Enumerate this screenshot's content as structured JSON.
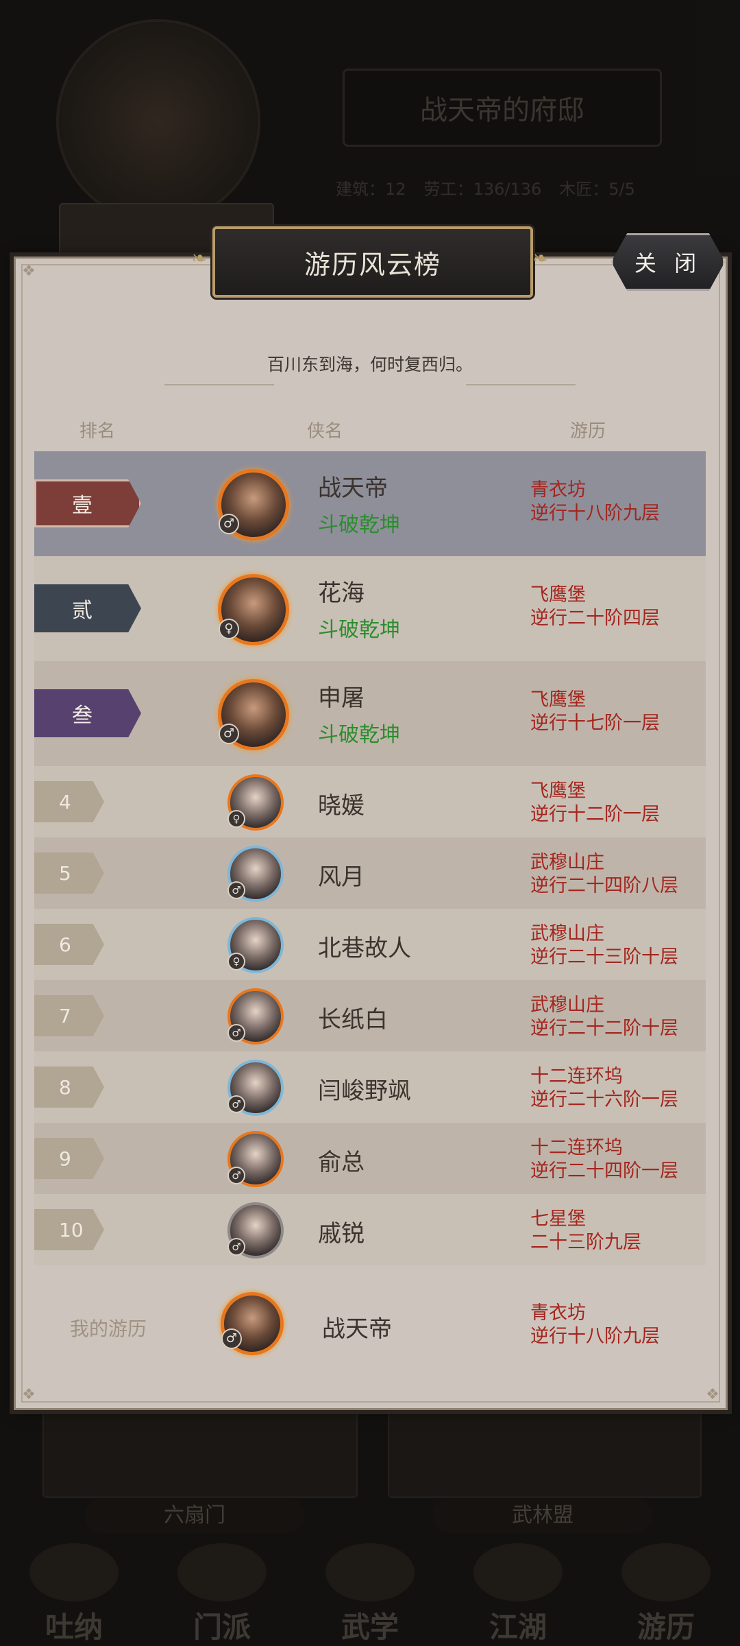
{
  "background": {
    "mansion_title": "战天帝的府邸",
    "stats": [
      "建筑：12",
      "劳工：136/136",
      "木匠：5/5"
    ],
    "cards": [
      "六扇门",
      "武林盟"
    ],
    "nav": [
      "吐纳",
      "门派",
      "武学",
      "江湖",
      "游历"
    ]
  },
  "modal": {
    "title": "游历风云榜",
    "close_label": "关 闭",
    "motto": "百川东到海，何时复西归。",
    "columns": {
      "rank": "排名",
      "name": "侠名",
      "travel": "游历"
    }
  },
  "rankings": [
    {
      "rank": "壹",
      "name": "战天帝",
      "sect": "斗破乾坤",
      "gender": "♂",
      "place": "青衣坊",
      "progress": "逆行十八阶九层"
    },
    {
      "rank": "贰",
      "name": "花海",
      "sect": "斗破乾坤",
      "gender": "♀",
      "place": "飞鹰堡",
      "progress": "逆行二十阶四层"
    },
    {
      "rank": "叁",
      "name": "申屠",
      "sect": "斗破乾坤",
      "gender": "♂",
      "place": "飞鹰堡",
      "progress": "逆行十七阶一层"
    },
    {
      "rank": "4",
      "name": "晓媛",
      "gender": "♀",
      "place": "飞鹰堡",
      "progress": "逆行十二阶一层"
    },
    {
      "rank": "5",
      "name": "风月",
      "gender": "♂",
      "place": "武穆山庄",
      "progress": "逆行二十四阶八层"
    },
    {
      "rank": "6",
      "name": "北巷故人",
      "gender": "♀",
      "place": "武穆山庄",
      "progress": "逆行二十三阶十层"
    },
    {
      "rank": "7",
      "name": "长纸白",
      "gender": "♂",
      "place": "武穆山庄",
      "progress": "逆行二十二阶十层"
    },
    {
      "rank": "8",
      "name": "闫峻野飒",
      "gender": "♂",
      "place": "十二连环坞",
      "progress": "逆行二十六阶一层"
    },
    {
      "rank": "9",
      "name": "俞总",
      "gender": "♂",
      "place": "十二连环坞",
      "progress": "逆行二十四阶一层"
    },
    {
      "rank": "10",
      "name": "戚锐",
      "gender": "♂",
      "place": "七星堡",
      "progress": "二十三阶九层"
    }
  ],
  "my_travel": {
    "label": "我的游历",
    "name": "战天帝",
    "gender": "♂",
    "place": "青衣坊",
    "progress": "逆行十八阶九层"
  },
  "colors": {
    "accent_green": "#2b8d2d",
    "accent_red": "#a3261f",
    "rank1": "#7d3d38",
    "rank2": "#3d4650",
    "rank3": "#56416f"
  }
}
